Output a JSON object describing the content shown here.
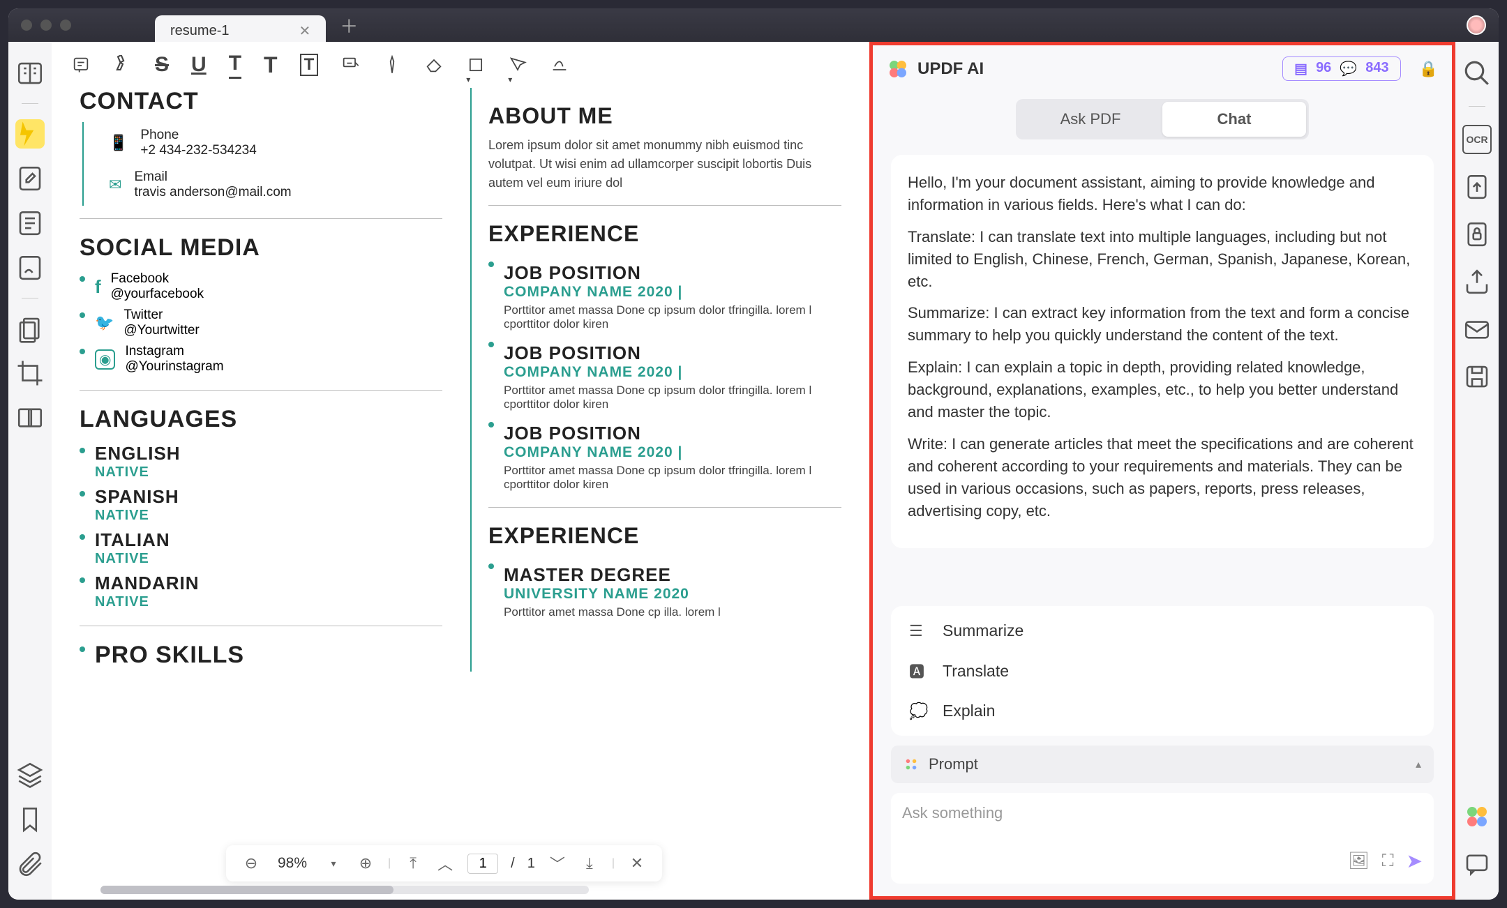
{
  "titlebar": {
    "tab_name": "resume-1"
  },
  "toolbar_icons": [
    "comment",
    "highlight",
    "strike",
    "underline",
    "text-style",
    "font",
    "text-box",
    "form",
    "pencil",
    "stamp",
    "shape",
    "eraser",
    "signature"
  ],
  "resume": {
    "contact": {
      "heading": "CONTACT",
      "phone": {
        "label": "Phone",
        "value": "+2 434-232-534234"
      },
      "email": {
        "label": "Email",
        "value": "travis anderson@mail.com"
      }
    },
    "social": {
      "heading": "SOCIAL MEDIA",
      "items": [
        {
          "name": "Facebook",
          "handle": "@yourfacebook"
        },
        {
          "name": "Twitter",
          "handle": "@Yourtwitter"
        },
        {
          "name": "Instagram",
          "handle": "@Yourinstagram"
        }
      ]
    },
    "languages": {
      "heading": "LANGUAGES",
      "items": [
        {
          "name": "ENGLISH",
          "level": "NATIVE"
        },
        {
          "name": "SPANISH",
          "level": "NATIVE"
        },
        {
          "name": "ITALIAN",
          "level": "NATIVE"
        },
        {
          "name": "MANDARIN",
          "level": "NATIVE"
        }
      ]
    },
    "skills": {
      "heading": "PRO SKILLS"
    },
    "about": {
      "heading": "ABOUT ME",
      "text": "Lorem ipsum dolor sit amet monummy nibh euismod tinc volutpat. Ut wisi enim ad ullamcorper suscipit lobortis Duis autem vel eum iriure dol"
    },
    "experience": {
      "heading": "EXPERIENCE",
      "jobs": [
        {
          "title": "JOB POSITION",
          "company": "COMPANY NAME 2020 |",
          "desc": "Porttitor amet massa Done cp ipsum dolor tfringilla. lorem l cporttitor dolor kiren"
        },
        {
          "title": "JOB POSITION",
          "company": "COMPANY NAME 2020 |",
          "desc": "Porttitor amet massa Done cp ipsum dolor tfringilla. lorem l cporttitor dolor kiren"
        },
        {
          "title": "JOB POSITION",
          "company": "COMPANY NAME 2020 |",
          "desc": "Porttitor amet massa Done cp ipsum dolor tfringilla. lorem l cporttitor dolor kiren"
        }
      ]
    },
    "education": {
      "heading": "EXPERIENCE",
      "degree": {
        "title": "MASTER DEGREE",
        "school": "UNIVERSITY NAME 2020",
        "desc": "Porttitor amet massa Done cp illa. lorem l"
      }
    }
  },
  "bottombar": {
    "zoom": "98%",
    "page": "1",
    "total": "1"
  },
  "ai": {
    "title": "UPDF AI",
    "count1": "96",
    "count2": "843",
    "tabs": {
      "ask": "Ask PDF",
      "chat": "Chat"
    },
    "message": {
      "intro": "Hello, I'm your document assistant, aiming to provide knowledge and information in various fields. Here's what I can do:",
      "translate": "Translate: I can translate text into multiple languages, including but not limited to English, Chinese, French, German, Spanish, Japanese, Korean, etc.",
      "summarize": "Summarize: I can extract key information from the text and form a concise summary to help you quickly understand the content of the text.",
      "explain": "Explain: I can explain a topic in depth, providing related knowledge, background, explanations, examples, etc., to help you better understand and master the topic.",
      "write": "Write: I can generate articles that meet the specifications and are coherent and coherent according to your requirements and materials. They can be used in various occasions, such as papers, reports, press releases, advertising copy, etc."
    },
    "actions": {
      "summarize": "Summarize",
      "translate": "Translate",
      "explain": "Explain"
    },
    "prompt_label": "Prompt",
    "input_placeholder": "Ask something"
  }
}
